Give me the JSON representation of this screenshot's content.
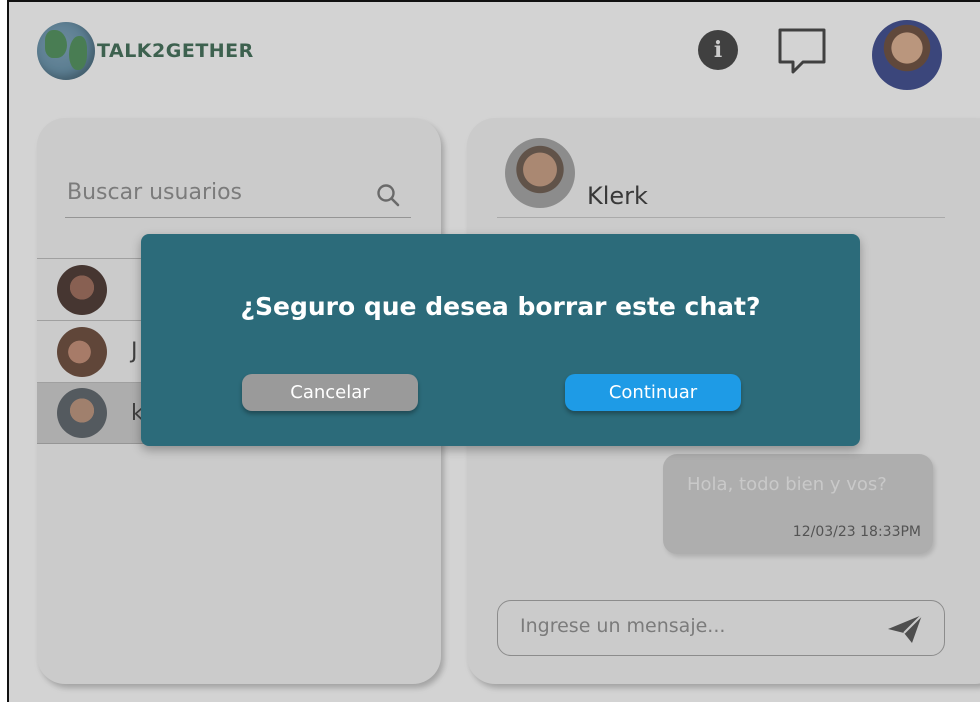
{
  "app": {
    "logo_text": "TALK2GETHER"
  },
  "header": {
    "info_icon": "info-icon",
    "chat_icon": "chat-bubble-icon",
    "avatar_icon": "user-avatar"
  },
  "sidebar": {
    "search_placeholder": "Buscar usuarios",
    "search_icon": "search-icon",
    "users": [
      {
        "name": ""
      },
      {
        "name": "J"
      },
      {
        "name": "k"
      }
    ]
  },
  "chat": {
    "contact_name": "Klerk",
    "messages": [
      {
        "text": "Hola, todo bien y vos?",
        "time": "12/03/23 18:33PM"
      }
    ],
    "input_placeholder": "Ingrese un mensaje...",
    "send_icon": "send-icon"
  },
  "modal": {
    "title": "¿Seguro que desea borrar este chat?",
    "cancel_label": "Cancelar",
    "continue_label": "Continuar"
  },
  "colors": {
    "modal_bg": "#2c6b7a",
    "continue_button": "#1e9be6",
    "cancel_button": "#9a9a9a",
    "logo_text": "#2f5b45"
  }
}
